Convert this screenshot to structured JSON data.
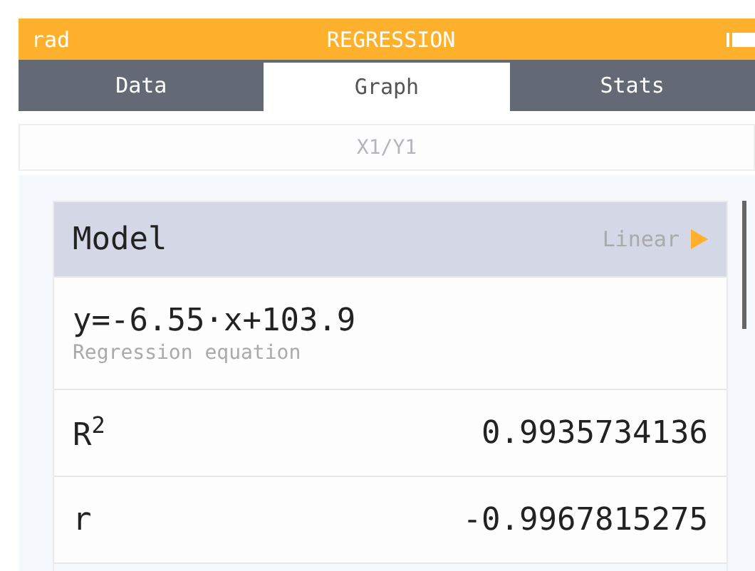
{
  "header": {
    "angle_unit": "rad",
    "title": "REGRESSION"
  },
  "tabs": [
    {
      "label": "Data",
      "selected": false
    },
    {
      "label": "Graph",
      "selected": true
    },
    {
      "label": "Stats",
      "selected": false
    }
  ],
  "series_bar": {
    "label": "X1/Y1"
  },
  "rows": [
    {
      "kind": "model",
      "label": "Model",
      "value": "Linear",
      "selected": true
    },
    {
      "kind": "equation",
      "value": "y=-6.55·x+103.9",
      "caption": "Regression equation"
    },
    {
      "kind": "stat",
      "label": "R$^{2}$",
      "value": "0.9935734136"
    },
    {
      "kind": "stat",
      "label": "r",
      "value": "-0.9967815275"
    }
  ]
}
